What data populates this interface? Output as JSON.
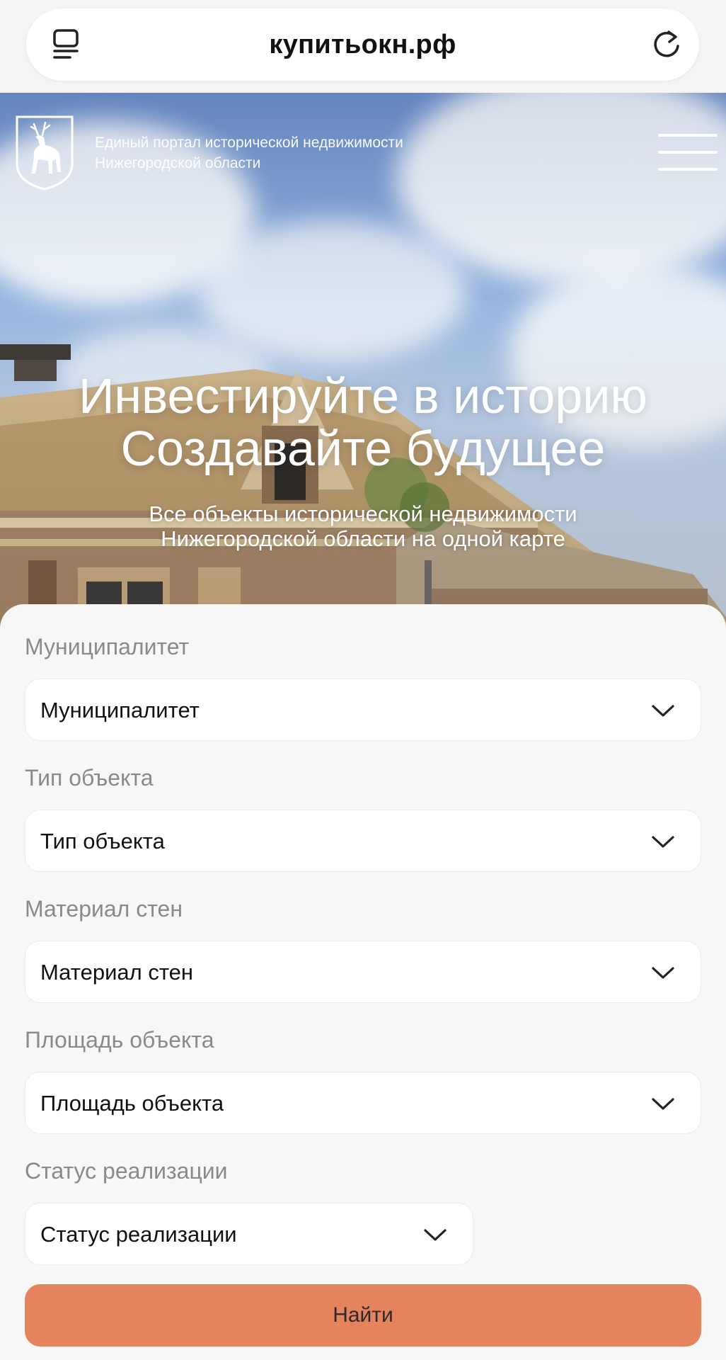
{
  "browser": {
    "url": "купитьокн.рф",
    "tabs_icon": "tabs-icon",
    "reload_icon": "reload-icon"
  },
  "header": {
    "logo_icon": "deer-coat-of-arms-icon",
    "portal_line1": "Единый портал исторической недвижимости",
    "portal_line2": "Нижегородской области",
    "menu_icon": "hamburger-menu-icon"
  },
  "hero": {
    "title_line1": "Инвестируйте в историю",
    "title_line2": "Создавайте будущее",
    "subtitle_line1": "Все объекты исторической недвижимости",
    "subtitle_line2": "Нижегородской области на одной карте"
  },
  "filters": [
    {
      "label": "Муниципалитет",
      "value": "Муниципалитет"
    },
    {
      "label": "Тип объекта",
      "value": "Тип объекта"
    },
    {
      "label": "Материал стен",
      "value": "Материал стен"
    },
    {
      "label": "Площадь объекта",
      "value": "Площадь объекта"
    },
    {
      "label": "Статус реализации",
      "value": "Статус реализации"
    }
  ],
  "search_button": "Найти",
  "colors": {
    "accent": "#e5835f",
    "card_background": "#f7f7f7",
    "label_gray": "#8a8a8a"
  }
}
